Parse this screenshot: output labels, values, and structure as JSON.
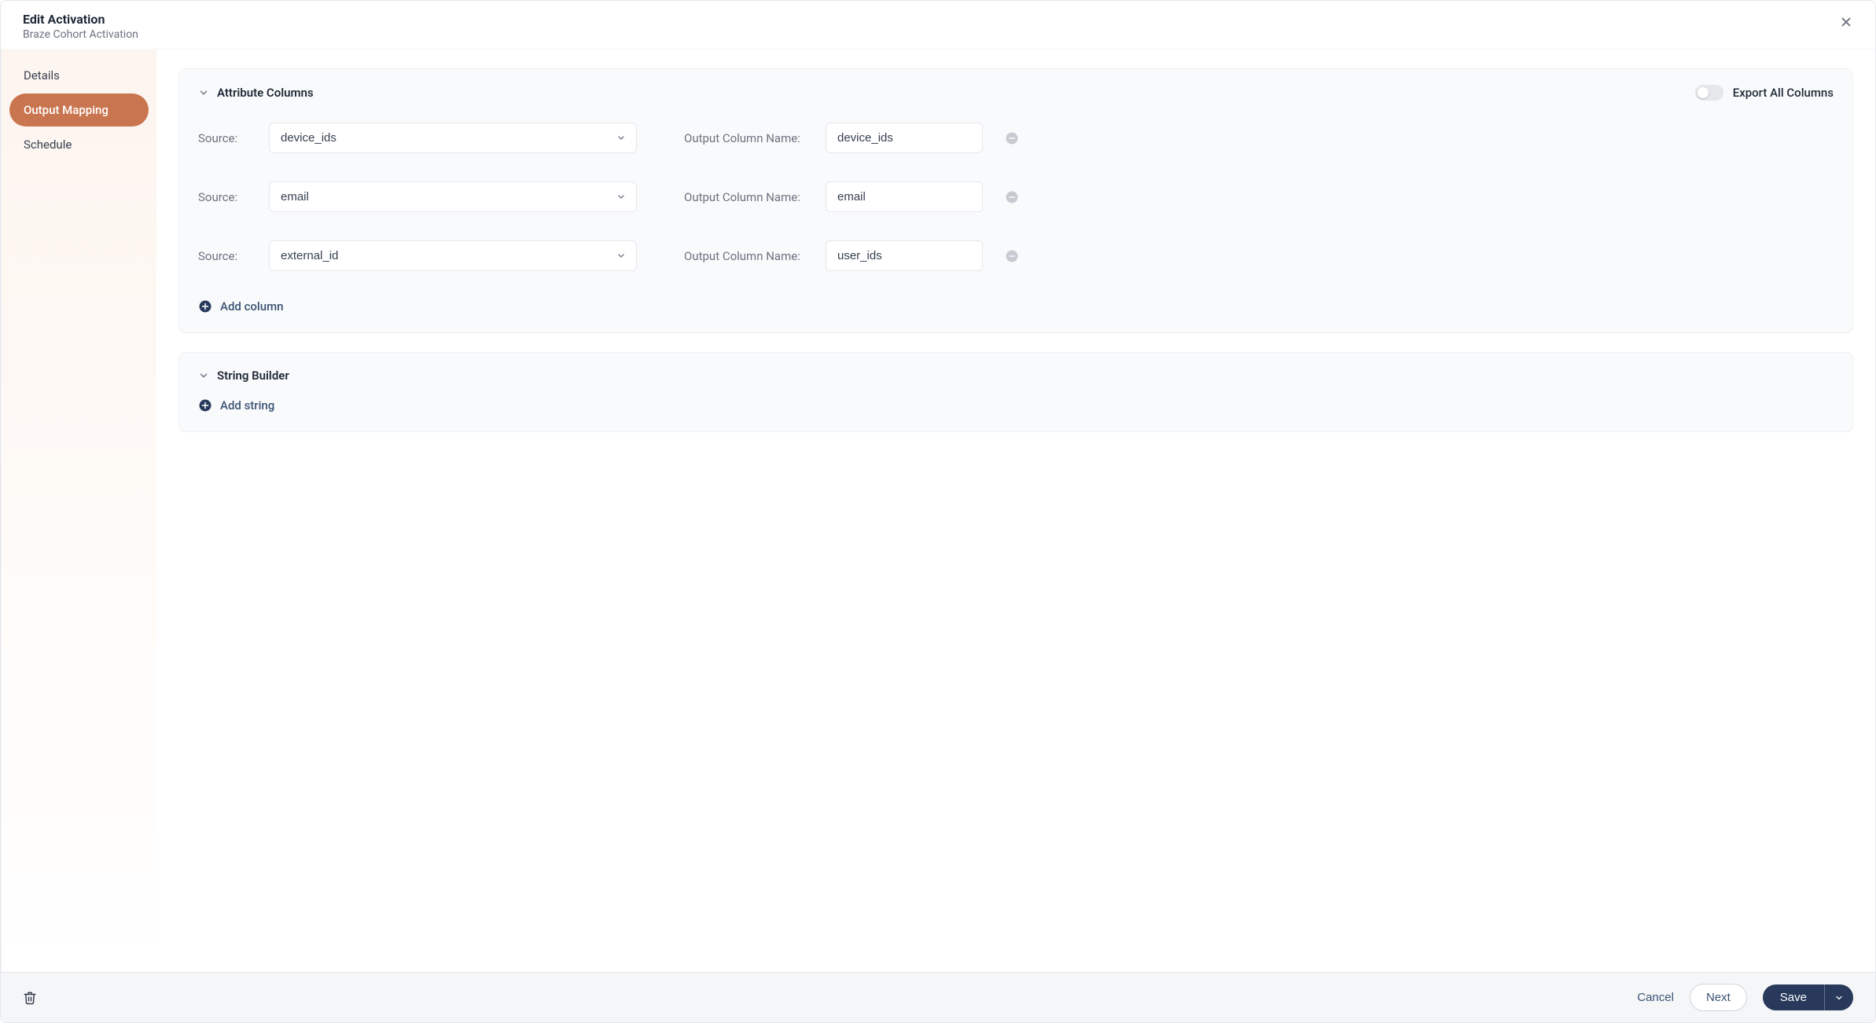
{
  "header": {
    "title": "Edit Activation",
    "subtitle": "Braze Cohort Activation"
  },
  "sidebar": {
    "items": [
      {
        "label": "Details"
      },
      {
        "label": "Output Mapping"
      },
      {
        "label": "Schedule"
      }
    ]
  },
  "panels": {
    "attribute": {
      "title": "Attribute Columns",
      "export_label": "Export All Columns",
      "source_label": "Source:",
      "output_label": "Output Column Name:",
      "rows": [
        {
          "source": "device_ids",
          "output": "device_ids"
        },
        {
          "source": "email",
          "output": "email"
        },
        {
          "source": "external_id",
          "output": "user_ids"
        }
      ],
      "add_label": "Add column"
    },
    "string_builder": {
      "title": "String Builder",
      "add_label": "Add string"
    }
  },
  "footer": {
    "cancel": "Cancel",
    "next": "Next",
    "save": "Save"
  }
}
